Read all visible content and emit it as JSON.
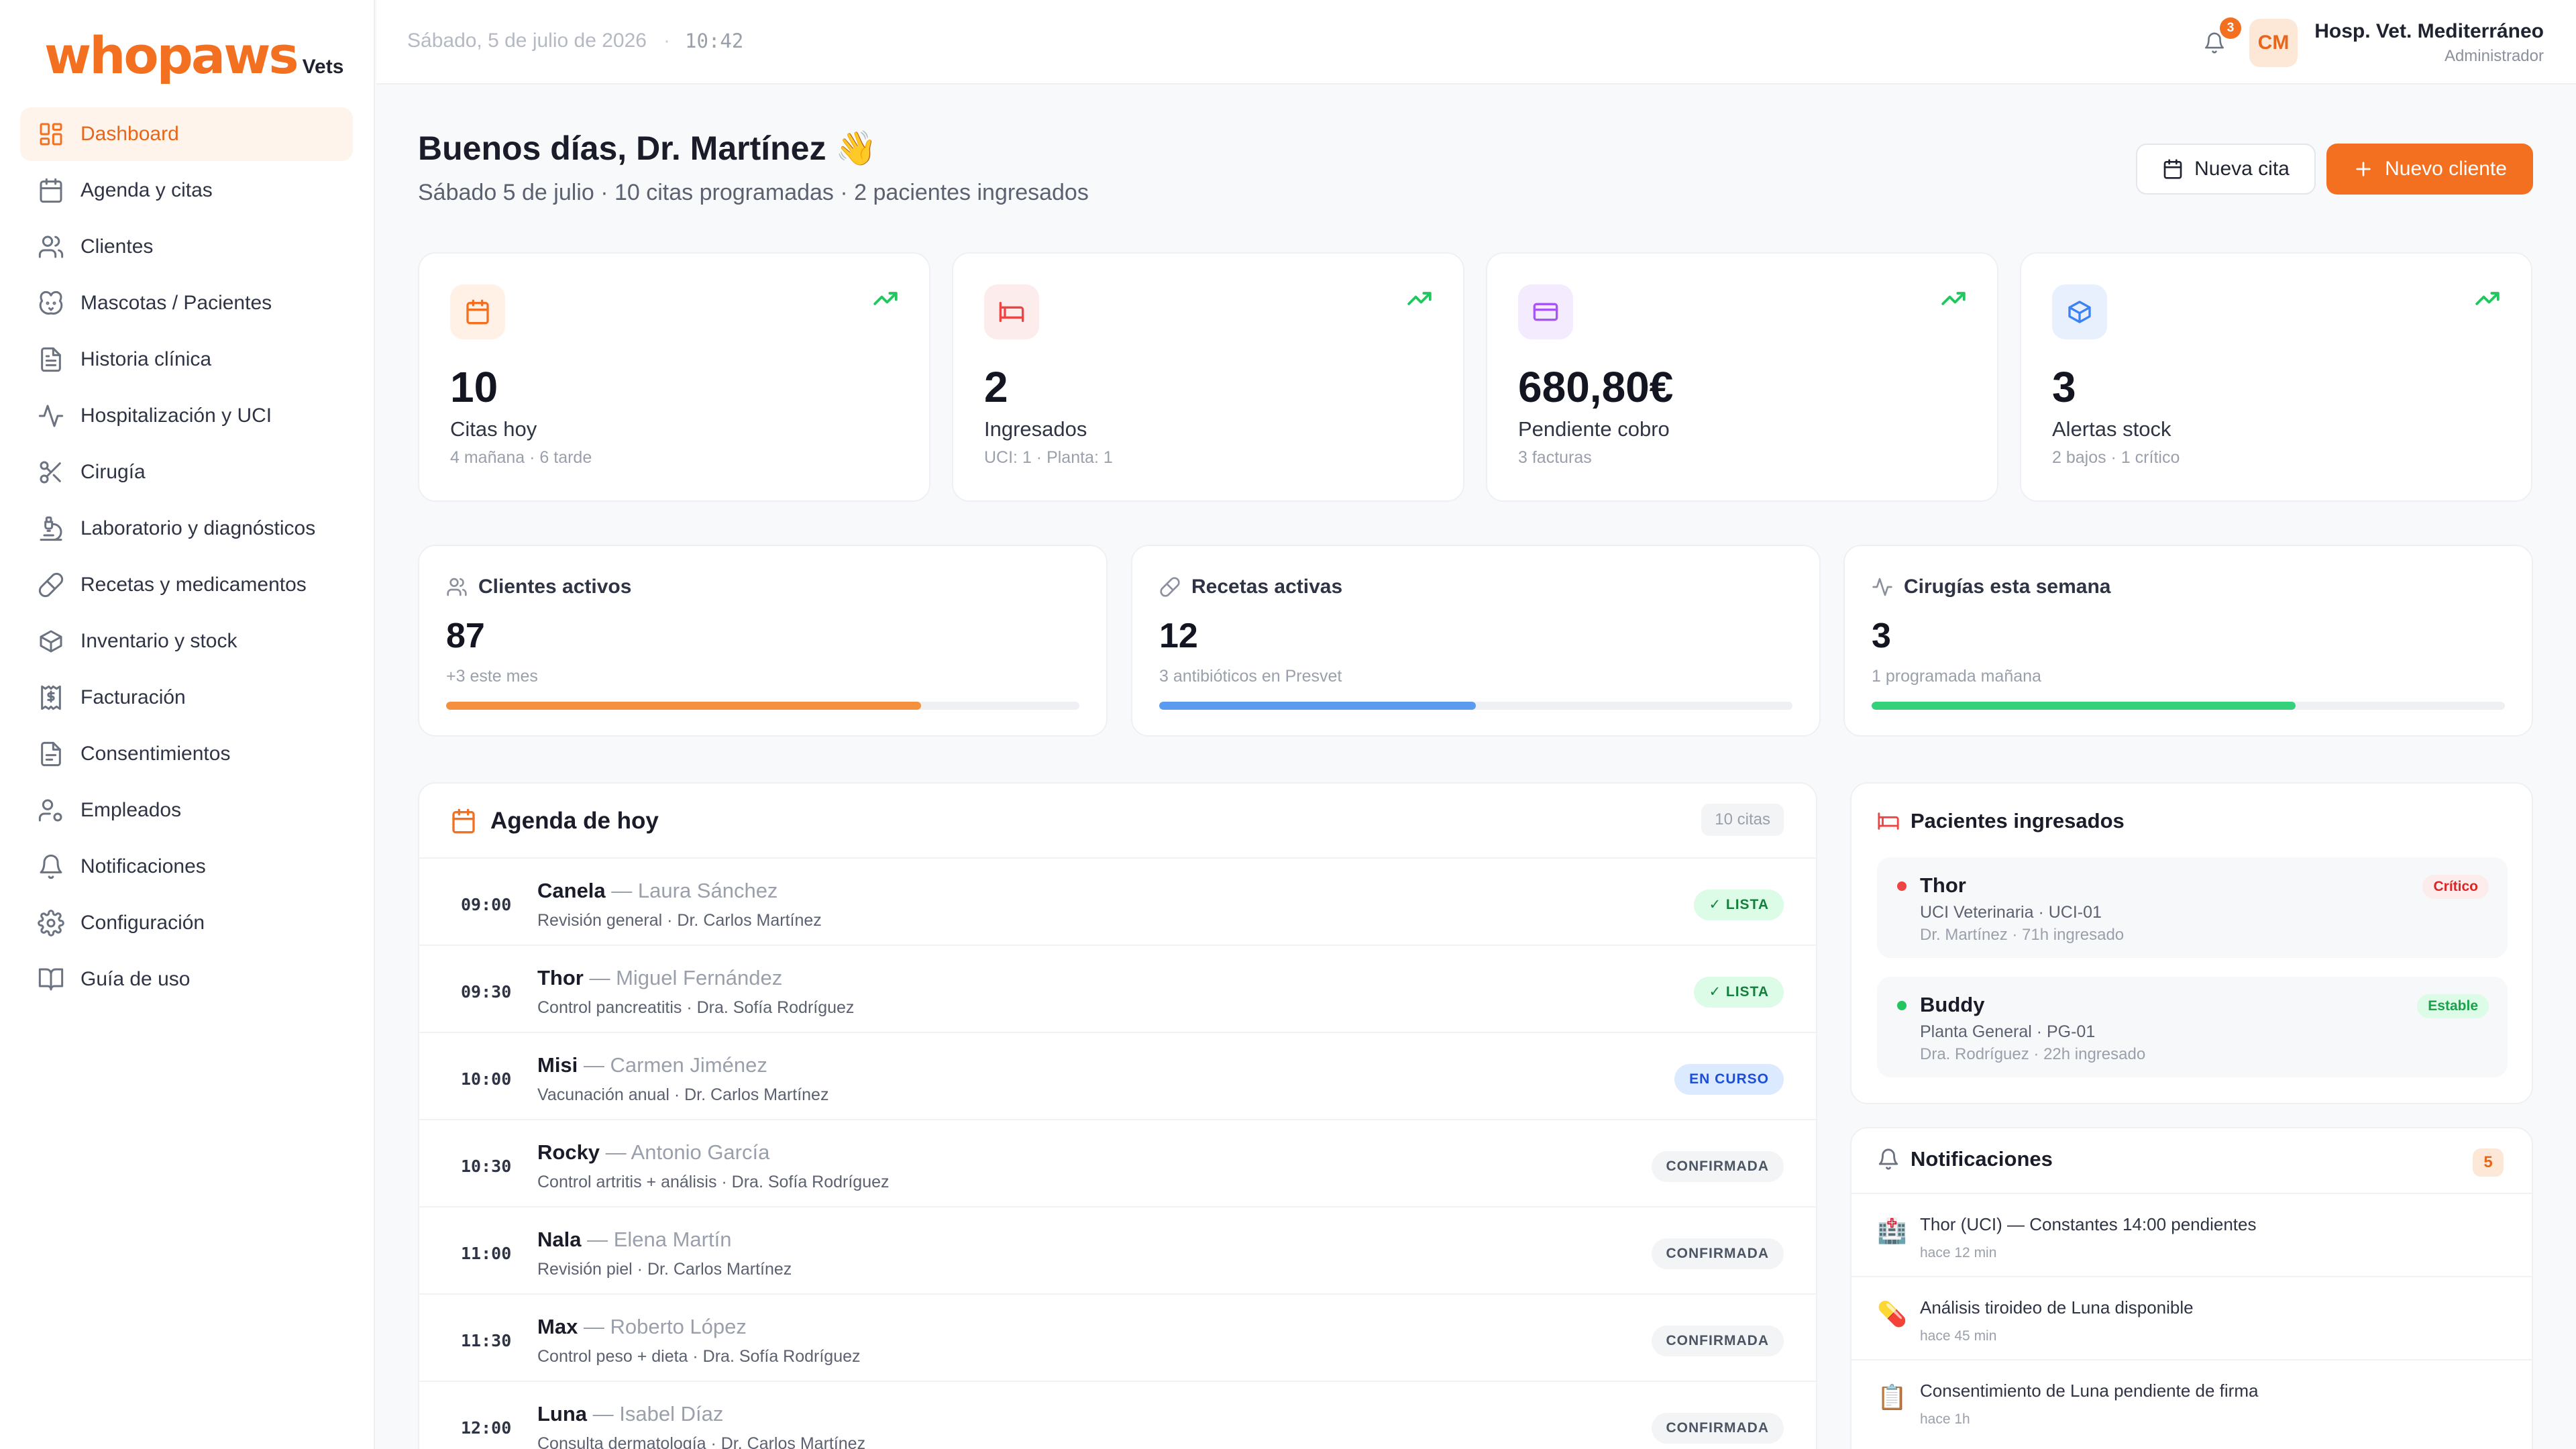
{
  "brand": {
    "name": "whopaws",
    "suffix": "Vets",
    "accent": "#f37021"
  },
  "sidebar": {
    "items": [
      {
        "label": "Dashboard",
        "icon": "grid-icon",
        "active": true
      },
      {
        "label": "Agenda y citas",
        "icon": "calendar-icon"
      },
      {
        "label": "Clientes",
        "icon": "users-icon"
      },
      {
        "label": "Mascotas / Pacientes",
        "icon": "paw-icon"
      },
      {
        "label": "Historia clínica",
        "icon": "file-text-icon"
      },
      {
        "label": "Hospitalización y UCI",
        "icon": "activity-icon"
      },
      {
        "label": "Cirugía",
        "icon": "scissors-icon"
      },
      {
        "label": "Laboratorio y diagnósticos",
        "icon": "microscope-icon"
      },
      {
        "label": "Recetas y medicamentos",
        "icon": "pill-icon"
      },
      {
        "label": "Inventario y stock",
        "icon": "package-icon"
      },
      {
        "label": "Facturación",
        "icon": "receipt-icon"
      },
      {
        "label": "Consentimientos",
        "icon": "document-icon"
      },
      {
        "label": "Empleados",
        "icon": "user-cog-icon"
      },
      {
        "label": "Notificaciones",
        "icon": "bell-icon"
      },
      {
        "label": "Configuración",
        "icon": "gear-icon"
      },
      {
        "label": "Guía de uso",
        "icon": "book-icon"
      }
    ]
  },
  "topbar": {
    "date": "Sábado, 5 de julio de 2026",
    "separator": "·",
    "time": "10:42",
    "notif_count": "3",
    "avatar": "CM",
    "hospital": "Hosp. Vet. Mediterráneo",
    "role": "Administrador"
  },
  "header": {
    "greeting": "Buenos días, Dr. Martínez 👋",
    "subtitle": "Sábado 5 de julio · 10 citas programadas · 2 pacientes ingresados",
    "btn_new_appt": "Nueva cita",
    "btn_new_client": "Nuevo cliente"
  },
  "stats": [
    {
      "value": "10",
      "label": "Citas hoy",
      "sub": "4 mañana · 6 tarde",
      "icon": "calendar-icon",
      "color": "#f37021",
      "bg": "#fff1e6"
    },
    {
      "value": "2",
      "label": "Ingresados",
      "sub": "UCI: 1 · Planta: 1",
      "icon": "bed-icon",
      "color": "#ef4444",
      "bg": "#fdecec"
    },
    {
      "value": "680,80€",
      "label": "Pendiente cobro",
      "sub": "3 facturas",
      "icon": "credit-card-icon",
      "color": "#a855f7",
      "bg": "#f5ebfe"
    },
    {
      "value": "3",
      "label": "Alertas stock",
      "sub": "2 bajos · 1 crítico",
      "icon": "package-icon",
      "color": "#3b82f6",
      "bg": "#e8f0fe"
    }
  ],
  "mid": [
    {
      "title": "Clientes activos",
      "value": "87",
      "sub": "+3 este mes",
      "progress": 0.75,
      "color": "#f5913e",
      "icon": "users-icon"
    },
    {
      "title": "Recetas activas",
      "value": "12",
      "sub": "3 antibióticos en Presvet",
      "progress": 0.5,
      "color": "#5b9bef",
      "icon": "pill-icon"
    },
    {
      "title": "Cirugías esta semana",
      "value": "3",
      "sub": "1 programada mañana",
      "progress": 0.67,
      "color": "#34d07a",
      "icon": "activity-icon"
    }
  ],
  "agenda": {
    "title": "Agenda de hoy",
    "count": "10 citas",
    "rows": [
      {
        "time": "09:00",
        "pet": "Canela",
        "owner": " — Laura Sánchez",
        "detail": "Revisión general · Dr. Carlos Martínez",
        "status": "✓ LISTA",
        "kind": "ok"
      },
      {
        "time": "09:30",
        "pet": "Thor",
        "owner": " — Miguel Fernández",
        "detail": "Control pancreatitis · Dra. Sofía Rodríguez",
        "status": "✓ LISTA",
        "kind": "ok"
      },
      {
        "time": "10:00",
        "pet": "Misi",
        "owner": " — Carmen Jiménez",
        "detail": "Vacunación anual · Dr. Carlos Martínez",
        "status": "EN CURSO",
        "kind": "prog"
      },
      {
        "time": "10:30",
        "pet": "Rocky",
        "owner": " — Antonio García",
        "detail": "Control artritis + análisis · Dra. Sofía Rodríguez",
        "status": "CONFIRMADA",
        "kind": "conf"
      },
      {
        "time": "11:00",
        "pet": "Nala",
        "owner": " — Elena Martín",
        "detail": "Revisión piel · Dr. Carlos Martínez",
        "status": "CONFIRMADA",
        "kind": "conf"
      },
      {
        "time": "11:30",
        "pet": "Max",
        "owner": " — Roberto López",
        "detail": "Control peso + dieta · Dra. Sofía Rodríguez",
        "status": "CONFIRMADA",
        "kind": "conf"
      },
      {
        "time": "12:00",
        "pet": "Luna",
        "owner": " — Isabel Díaz",
        "detail": "Consulta dermatología · Dr. Carlos Martínez",
        "status": "CONFIRMADA",
        "kind": "conf"
      }
    ]
  },
  "patients": {
    "title": "Pacientes ingresados",
    "items": [
      {
        "name": "Thor",
        "location": "UCI Veterinaria · UCI-01",
        "doctor": "Dr. Martínez · 71h ingresado",
        "state": "Crítico",
        "dot": "#ef4444",
        "state_bg": "#fdecec",
        "state_color": "#dc2626"
      },
      {
        "name": "Buddy",
        "location": "Planta General · PG-01",
        "doctor": "Dra. Rodríguez · 22h ingresado",
        "state": "Estable",
        "dot": "#22c55e",
        "state_bg": "#dcfce7",
        "state_color": "#16a34a"
      }
    ]
  },
  "notifications": {
    "title": "Notificaciones",
    "count": "5",
    "items": [
      {
        "icon": "🏥",
        "text": "Thor (UCI) — Constantes 14:00 pendientes",
        "time": "hace 12 min"
      },
      {
        "icon": "💊",
        "text": "Análisis tiroideo de Luna disponible",
        "time": "hace 45 min"
      },
      {
        "icon": "📋",
        "text": "Consentimiento de Luna pendiente de firma",
        "time": "hace 1h"
      }
    ]
  }
}
